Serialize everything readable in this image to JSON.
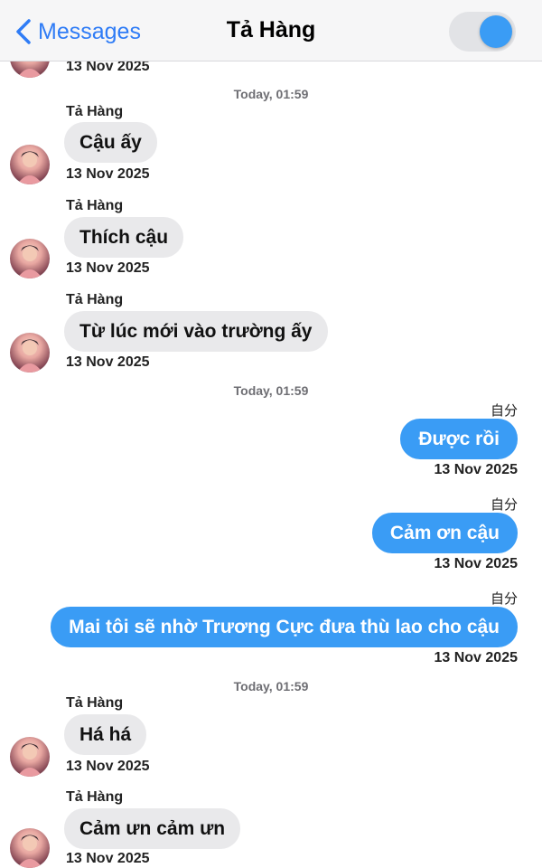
{
  "header": {
    "back_label": "Messages",
    "title": "Tả Hàng",
    "colors": {
      "accent": "#2f7cf6",
      "toggle_knob": "#3a9cf5"
    }
  },
  "top_partial": {
    "date": "13 Nov 2025"
  },
  "separators": [
    "Today, 01:59",
    "Today, 01:59",
    "Today, 01:59"
  ],
  "incoming_group1": [
    {
      "sender": "Tả Hàng",
      "text": "Cậu ấy",
      "date": "13 Nov 2025"
    },
    {
      "sender": "Tả Hàng",
      "text": "Thích cậu",
      "date": "13 Nov 2025"
    },
    {
      "sender": "Tả Hàng",
      "text": "Từ lúc mới vào trường ấy",
      "date": "13 Nov 2025"
    }
  ],
  "outgoing": [
    {
      "label": "自分",
      "text": "Được rồi",
      "date": "13 Nov 2025"
    },
    {
      "label": "自分",
      "text": "Cảm ơn cậu",
      "date": "13 Nov 2025"
    },
    {
      "label": "自分",
      "text": "Mai tôi sẽ nhờ Trương Cực đưa thù lao cho cậu",
      "date": "13 Nov 2025"
    }
  ],
  "incoming_group2": [
    {
      "sender": "Tả Hàng",
      "text": "Há há",
      "date": "13 Nov 2025"
    },
    {
      "sender": "Tả Hàng",
      "text": "Cảm ưn cảm ưn",
      "date": "13 Nov 2025"
    }
  ],
  "bubble_colors": {
    "incoming": "#e9e9eb",
    "outgoing": "#3a9cf5"
  }
}
